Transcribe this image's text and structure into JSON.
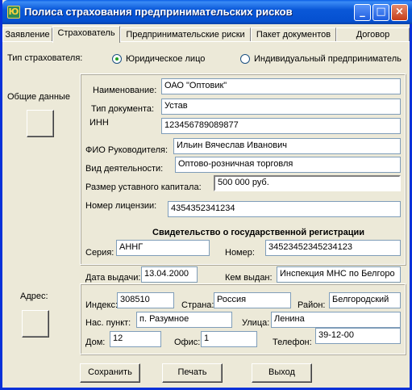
{
  "window": {
    "title": "Полиса страхования предпринимательских рисков",
    "icon": "app-icon",
    "icon_glyph": "Ю"
  },
  "tabs": [
    "Заявление",
    "Страхователь",
    "Предпринимательские риски",
    "Пакет документов",
    "Договор"
  ],
  "active_tab": "Страхователь",
  "insurer_type": {
    "label": "Тип страхователя:",
    "options": [
      "Юридическое лицо",
      "Индивидуальный предприниматель"
    ],
    "selected": "Юридическое лицо"
  },
  "general": {
    "button_label": "Общие данные",
    "name_label": "Наименование:",
    "name": "ОАО \"Оптовик\"",
    "doctype_label": "Тип документа:",
    "doctype": "Устав",
    "inn_label": "ИНН",
    "inn": "123456789089877",
    "director_label": "ФИО Руководителя:",
    "director": "Ильин Вячеслав Иванович",
    "activity_label": "Вид деятельности:",
    "activity": "Оптово-розничная торговля",
    "capital_label": "Размер уставного капитала:",
    "capital": "500 000 руб.",
    "license_label": "Номер лицензии:",
    "license": "4354352341234"
  },
  "registration": {
    "heading": "Свидетельство о государственной регистрации",
    "series_label": "Серия:",
    "series": "АННГ",
    "number_label": "Номер:",
    "number": "34523452345234123",
    "date_label": "Дата выдачи:",
    "date": "13.04.2000",
    "issuer_label": "Кем выдан:",
    "issuer": "Инспекция МНС по Белгоро"
  },
  "address": {
    "button_label": "Адрес:",
    "index_label": "Индекс:",
    "index": "308510",
    "country_label": "Страна:",
    "country": "Россия",
    "region_label": "Район:",
    "region": "Белгородский",
    "locality_label": "Нас. пункт:",
    "locality": "п. Разумное",
    "street_label": "Улица:",
    "street": "Ленина",
    "house_label": "Дом:",
    "house": "12",
    "office_label": "Офис:",
    "office": "1",
    "phone_label": "Телефон:",
    "phone": "39-12-00"
  },
  "actions": {
    "save": "Сохранить",
    "print": "Печать",
    "exit": "Выход"
  }
}
